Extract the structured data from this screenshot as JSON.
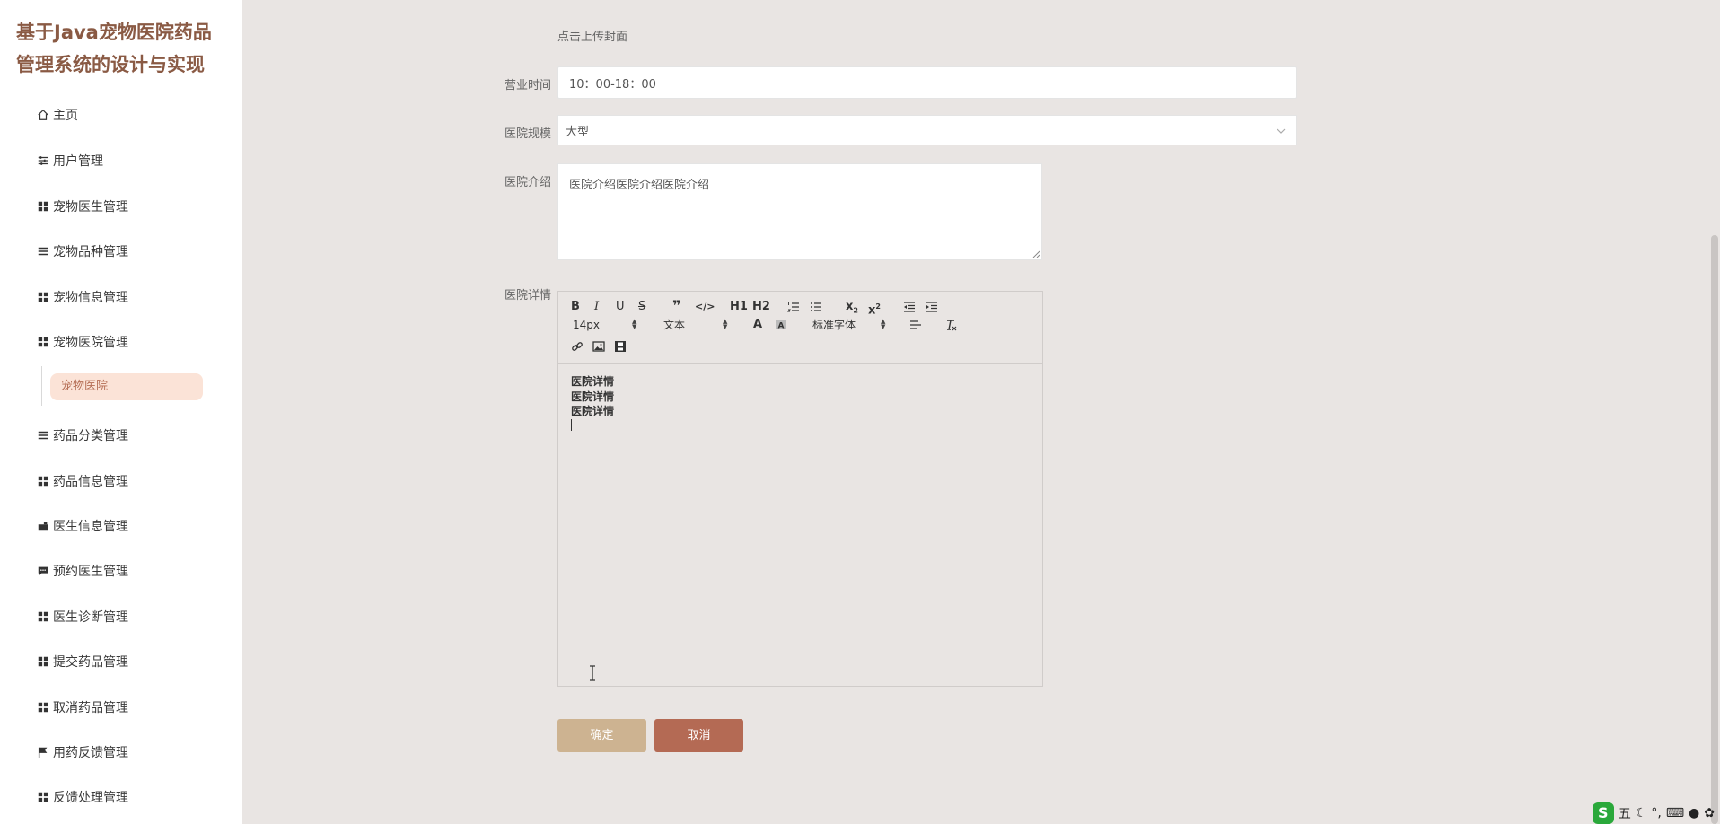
{
  "sidebar": {
    "title": "基于Java宠物医院药品管理系统的设计与实现",
    "items": [
      {
        "label": "主页",
        "icon": "home-icon"
      },
      {
        "label": "用户管理",
        "icon": "sliders-icon"
      },
      {
        "label": "宠物医生管理",
        "icon": "grid-icon"
      },
      {
        "label": "宠物品种管理",
        "icon": "list-icon"
      },
      {
        "label": "宠物信息管理",
        "icon": "grid-icon"
      },
      {
        "label": "宠物医院管理",
        "icon": "grid-icon"
      },
      {
        "label": "药品分类管理",
        "icon": "list-icon"
      },
      {
        "label": "药品信息管理",
        "icon": "grid-icon"
      },
      {
        "label": "医生信息管理",
        "icon": "camera-icon"
      },
      {
        "label": "预约医生管理",
        "icon": "chat-icon"
      },
      {
        "label": "医生诊断管理",
        "icon": "grid-icon"
      },
      {
        "label": "提交药品管理",
        "icon": "grid-icon"
      },
      {
        "label": "取消药品管理",
        "icon": "grid-icon"
      },
      {
        "label": "用药反馈管理",
        "icon": "flag-icon"
      },
      {
        "label": "反馈处理管理",
        "icon": "grid-icon"
      }
    ],
    "submenu_active": "宠物医院"
  },
  "form": {
    "cover_hint": "点击上传封面",
    "hours": {
      "label": "营业时间",
      "value": "10：00-18：00"
    },
    "scale": {
      "label": "医院规模",
      "value": "大型"
    },
    "intro": {
      "label": "医院介绍",
      "value": "医院介绍医院介绍医院介绍"
    },
    "detail": {
      "label": "医院详情",
      "toolbar": {
        "font_size": "14px",
        "header": "文本",
        "font_family": "标准字体",
        "h1": "H1",
        "h2": "H2"
      },
      "lines": [
        "医院详情",
        "医院详情",
        "医院详情"
      ]
    },
    "confirm_label": "确定",
    "cancel_label": "取消"
  },
  "ime": {
    "logo": "S",
    "mode": "五",
    "punct": "°,"
  },
  "colors": {
    "background": "#e9e5e3",
    "title": "#8a5a44",
    "submenu_bg": "#fbe3d7",
    "confirm_button": "#cdb391",
    "cancel_button": "#b46a54"
  }
}
